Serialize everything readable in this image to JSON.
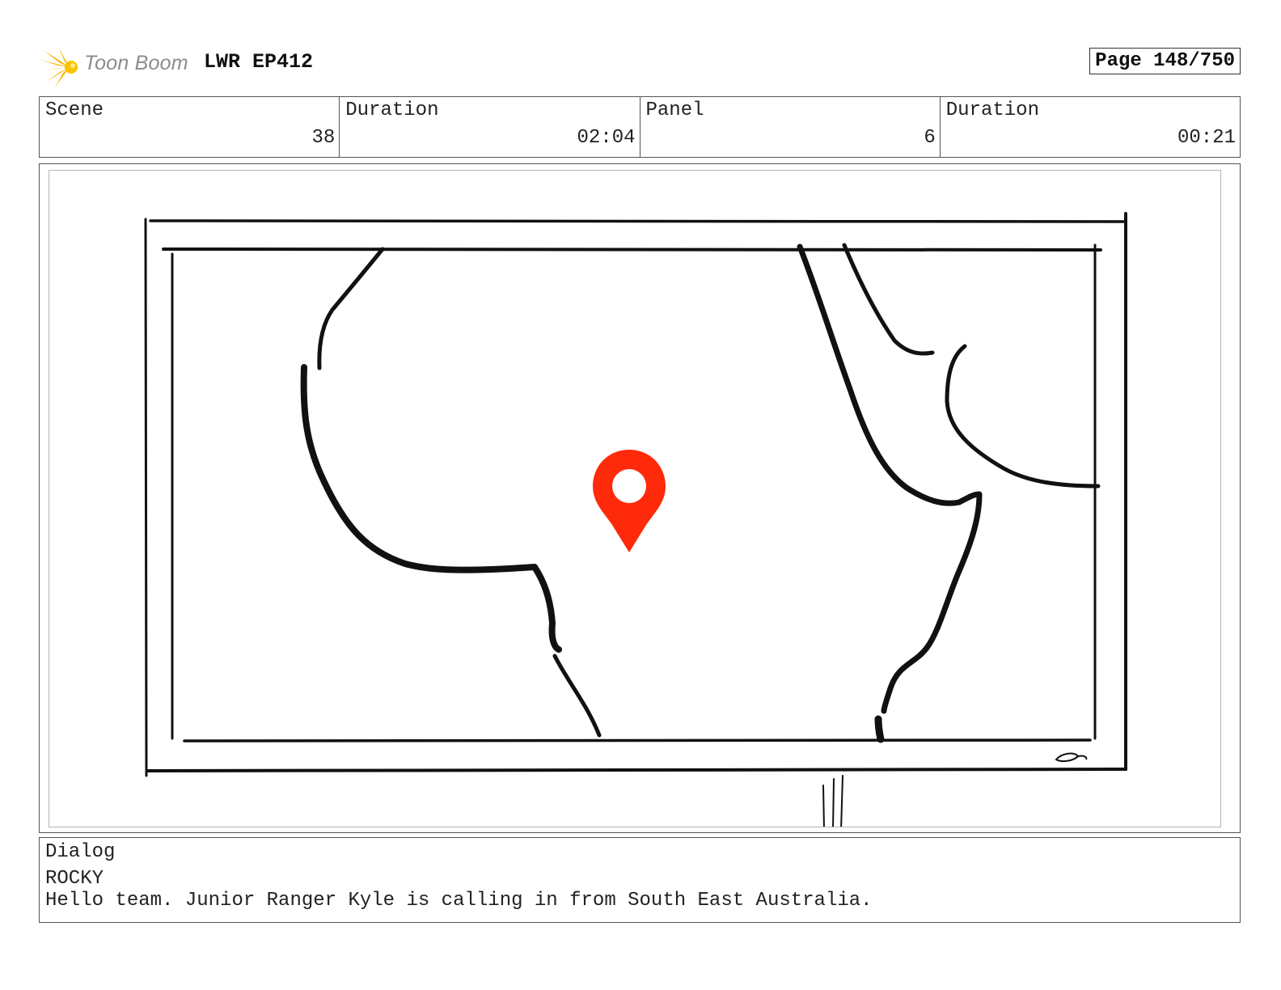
{
  "header": {
    "brand": "Toon Boom",
    "project": "LWR EP412",
    "page_label": "Page 148/750"
  },
  "info": [
    {
      "label": "Scene",
      "value": "38"
    },
    {
      "label": "Duration",
      "value": "02:04"
    },
    {
      "label": "Panel",
      "value": "6"
    },
    {
      "label": "Duration",
      "value": "00:21"
    }
  ],
  "dialog": {
    "label": "Dialog",
    "speaker": "ROCKY",
    "line": "Hello team. Junior Ranger Kyle is calling in from South East Australia."
  },
  "colors": {
    "logo_yellow": "#f5b800",
    "pin_red": "#ff2a0a",
    "sketch_ink": "#111111"
  },
  "icons": [
    "toon-boom-logo-icon",
    "location-pin-icon",
    "sketch-signature-icon"
  ]
}
